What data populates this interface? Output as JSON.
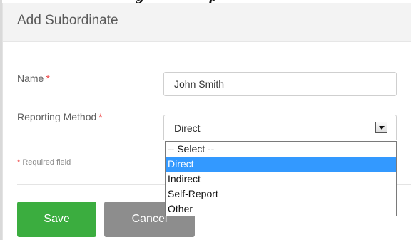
{
  "top_caption_fragment": "g      p",
  "panel": {
    "title": "Add Subordinate"
  },
  "form": {
    "name_label": "Name",
    "name_value": "John Smith",
    "reporting_label": "Reporting Method",
    "required_star": "*",
    "reporting_value": "Direct",
    "required_note": "Required field"
  },
  "dropdown": {
    "options": [
      "-- Select --",
      "Direct",
      "Indirect",
      "Self-Report",
      "Other"
    ],
    "highlighted": "Direct"
  },
  "buttons": {
    "save": "Save",
    "cancel": "Cancel"
  },
  "colors": {
    "save": "#3bad3f",
    "cancel": "#8d8d8d",
    "highlight": "#3399ff",
    "required": "#e44444"
  }
}
